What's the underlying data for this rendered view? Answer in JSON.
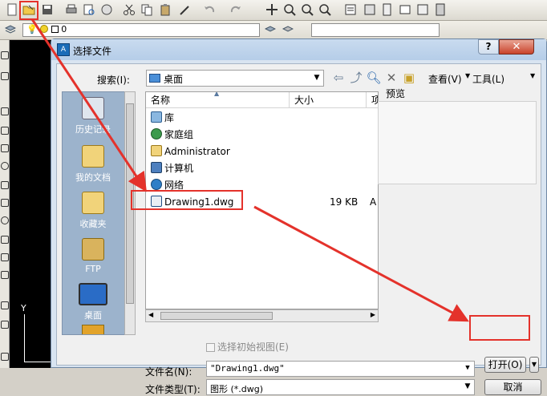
{
  "app": {
    "layer_value": "0"
  },
  "dialog": {
    "title": "选择文件",
    "help_label": "?",
    "close_label": "✕",
    "lookin_label": "搜索(I):",
    "lookin_value": "桌面",
    "view_label": "查看(V)",
    "tools_label": "工具(L)",
    "preview_label": "预览",
    "places": [
      {
        "label": "历史记录",
        "icon": "history-icon"
      },
      {
        "label": "我的文档",
        "icon": "documents-folder-icon"
      },
      {
        "label": "收藏夹",
        "icon": "favorites-folder-icon"
      },
      {
        "label": "FTP",
        "icon": "ftp-folder-icon"
      },
      {
        "label": "桌面",
        "icon": "desktop-icon"
      }
    ],
    "columns": [
      "名称",
      "大小",
      "项"
    ],
    "files": [
      {
        "name": "库",
        "size": "",
        "type": "",
        "icon": "library-icon"
      },
      {
        "name": "家庭组",
        "size": "",
        "type": "",
        "icon": "homegroup-icon"
      },
      {
        "name": "Administrator",
        "size": "",
        "type": "",
        "icon": "user-folder-icon"
      },
      {
        "name": "计算机",
        "size": "",
        "type": "",
        "icon": "computer-icon"
      },
      {
        "name": "网络",
        "size": "",
        "type": "",
        "icon": "network-icon"
      },
      {
        "name": "Drawing1.dwg",
        "size": "19 KB",
        "type": "A",
        "icon": "dwg-file-icon"
      }
    ],
    "initial_view_label": "选择初始视图(E)",
    "filename_label": "文件名(N):",
    "filename_value": "\"Drawing1.dwg\"",
    "filetype_label": "文件类型(T):",
    "filetype_value": "图形 (*.dwg)",
    "open_label": "打开(O)",
    "cancel_label": "取消"
  },
  "canvas": {
    "ucs_y_label": "Y"
  },
  "colors": {
    "annotation": "#e4322b",
    "places_bar": "#9cb3cc",
    "title_bar": "#c9dbef"
  }
}
